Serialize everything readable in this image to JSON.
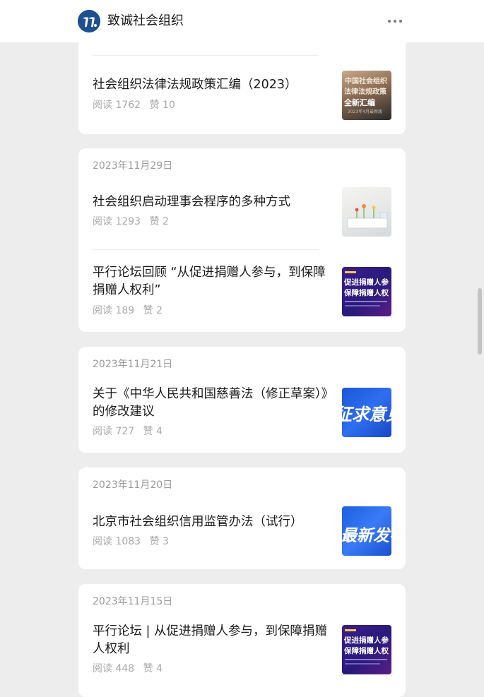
{
  "header": {
    "account_name": "致诚社会组织",
    "logo_icon": "account-logo-icon",
    "more_icon": "more-dots-icon"
  },
  "ui": {
    "read_label": "阅读",
    "like_label": "赞"
  },
  "groups": [
    {
      "items": [
        {
          "title": "社会组织法律法规政策汇编（2023）",
          "reads": "1762",
          "likes": "10",
          "thumb_lines": [
            "中国社会组织",
            "法律法规政策",
            "全新汇编",
            "2023年4月最新版"
          ]
        }
      ]
    },
    {
      "date": "2023年11月29日",
      "items": [
        {
          "title": "社会组织启动理事会程序的多种方式",
          "reads": "1293",
          "likes": "2"
        },
        {
          "title": "平行论坛回顾 “从促进捐赠人参与，到保障捐赠人权利”",
          "reads": "189",
          "likes": "2",
          "thumb_lines": [
            "促进捐赠人参",
            "保障捐赠人权"
          ]
        }
      ]
    },
    {
      "date": "2023年11月21日",
      "items": [
        {
          "title": "关于《中华人民共和国慈善法（修正草案）》的修改建议",
          "reads": "727",
          "likes": "4",
          "thumb_lines": [
            "征求意见"
          ]
        }
      ]
    },
    {
      "date": "2023年11月20日",
      "items": [
        {
          "title": "北京市社会组织信用监管办法（试行）",
          "reads": "1083",
          "likes": "3",
          "thumb_lines": [
            "最新发布"
          ]
        }
      ]
    },
    {
      "date": "2023年11月15日",
      "items": [
        {
          "title": "平行论坛 | 从促进捐赠人参与，到保障捐赠人权利",
          "reads": "448",
          "likes": "4",
          "thumb_lines": [
            "促进捐赠人参",
            "保障捐赠人权"
          ]
        }
      ]
    }
  ]
}
